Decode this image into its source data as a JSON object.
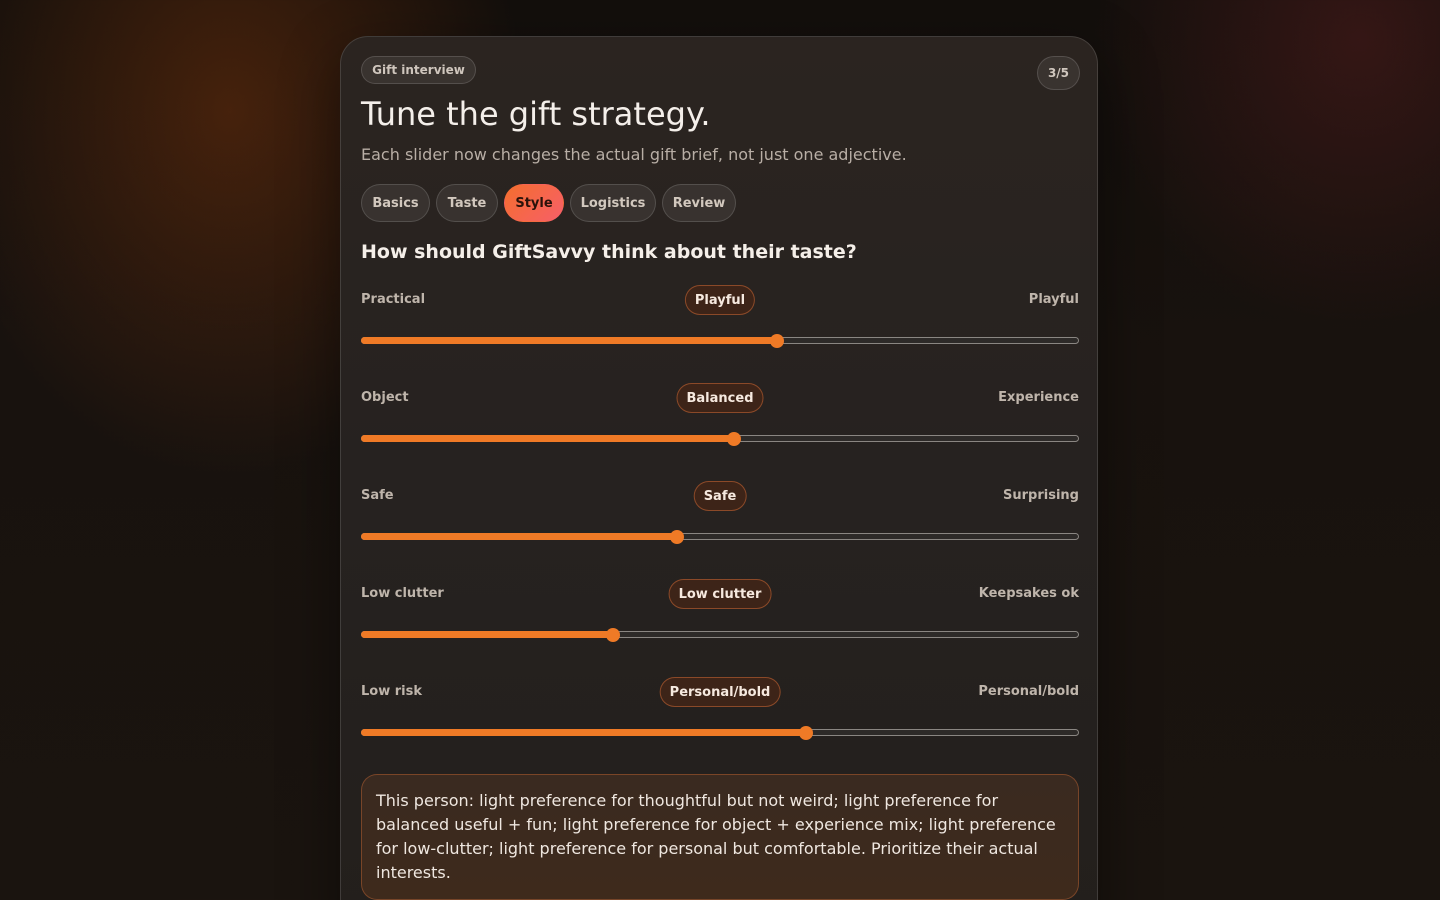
{
  "header": {
    "eyebrow": "Gift interview",
    "step": "3/5",
    "title": "Tune the gift strategy.",
    "subtitle": "Each slider now changes the actual gift brief, not just one adjective."
  },
  "tabs": [
    {
      "label": "Basics",
      "active": false
    },
    {
      "label": "Taste",
      "active": false
    },
    {
      "label": "Style",
      "active": true
    },
    {
      "label": "Logistics",
      "active": false
    },
    {
      "label": "Review",
      "active": false
    }
  ],
  "question": "How should GiftSavvy think about their taste?",
  "sliders": [
    {
      "left": "Practical",
      "right": "Playful",
      "value_label": "Playful",
      "value": 0.58
    },
    {
      "left": "Object",
      "right": "Experience",
      "value_label": "Balanced",
      "value": 0.52
    },
    {
      "left": "Safe",
      "right": "Surprising",
      "value_label": "Safe",
      "value": 0.44
    },
    {
      "left": "Low clutter",
      "right": "Keepsakes ok",
      "value_label": "Low clutter",
      "value": 0.35
    },
    {
      "left": "Low risk",
      "right": "Personal/bold",
      "value_label": "Personal/bold",
      "value": 0.62
    }
  ],
  "summary": "This person: light preference for thoughtful but not weird; light preference for balanced useful + fun; light preference for object + experience mix; light preference for low-clutter; light preference for personal but comfortable. Prioritize their actual interests.",
  "colors": {
    "accent": "#ef7a26",
    "active_tab_start": "#f46e2e",
    "active_tab_end": "#f75f68"
  }
}
